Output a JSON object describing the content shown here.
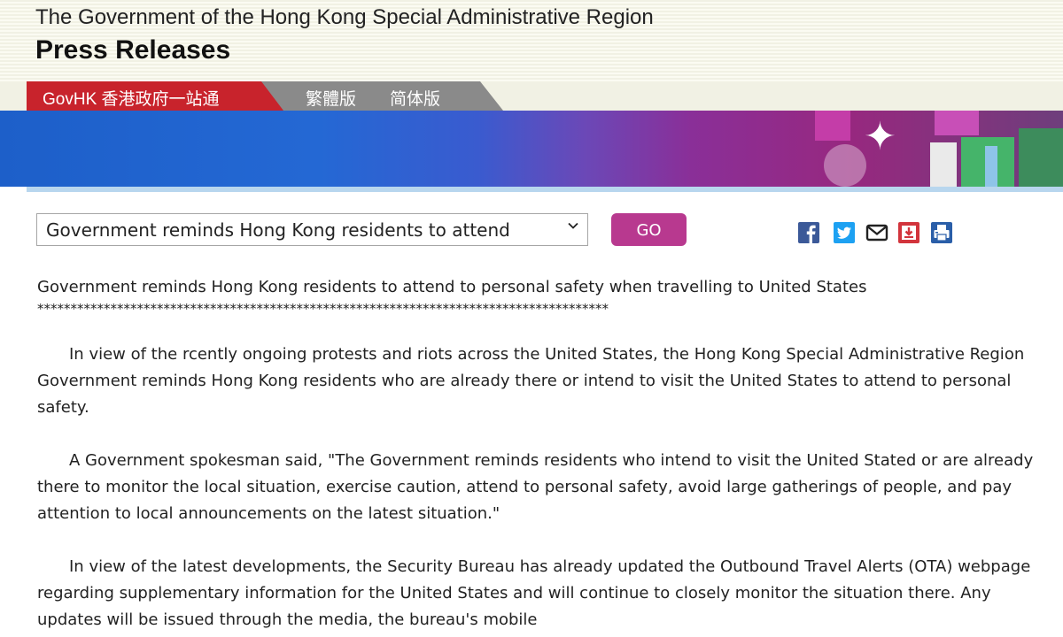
{
  "header": {
    "government_title": "The Government of the Hong Kong Special Administrative Region",
    "page_title": "Press Releases"
  },
  "tabs": {
    "govhk_label": "GovHK 香港政府一站通",
    "traditional_label": "繁體版",
    "simplified_label": "简体版"
  },
  "toolbar": {
    "selected_release": "Government reminds Hong Kong residents to attend",
    "go_label": "GO"
  },
  "article": {
    "headline": "Government reminds Hong Kong residents to attend to personal safety when travelling to United States",
    "separator": "**************************************************************************************",
    "paragraphs": [
      "In view of the rcently ongoing protests and riots across the United States, the Hong Kong Special Administrative Region Government reminds Hong Kong residents who are already there or intend to visit the United States to attend to personal safety.",
      "A Government spokesman said, \"The Government reminds residents who intend to visit the United Stated or are already there to monitor the local situation, exercise caution, attend to personal safety, avoid large gatherings of people, and pay attention to local announcements on the latest situation.\"",
      "In view of the latest developments, the Security Bureau has already updated the Outbound Travel Alerts (OTA) webpage regarding supplementary information for the United States and will continue to closely monitor the situation there. Any updates will be issued through the media, the bureau's mobile"
    ]
  },
  "colors": {
    "govhk_red": "#c8232c",
    "go_button": "#b8398f",
    "banner_blue": "#1d5fc9",
    "banner_purple": "#97287f"
  },
  "icons": [
    "facebook-icon",
    "twitter-icon",
    "email-icon",
    "bookmark-icon",
    "print-icon"
  ]
}
